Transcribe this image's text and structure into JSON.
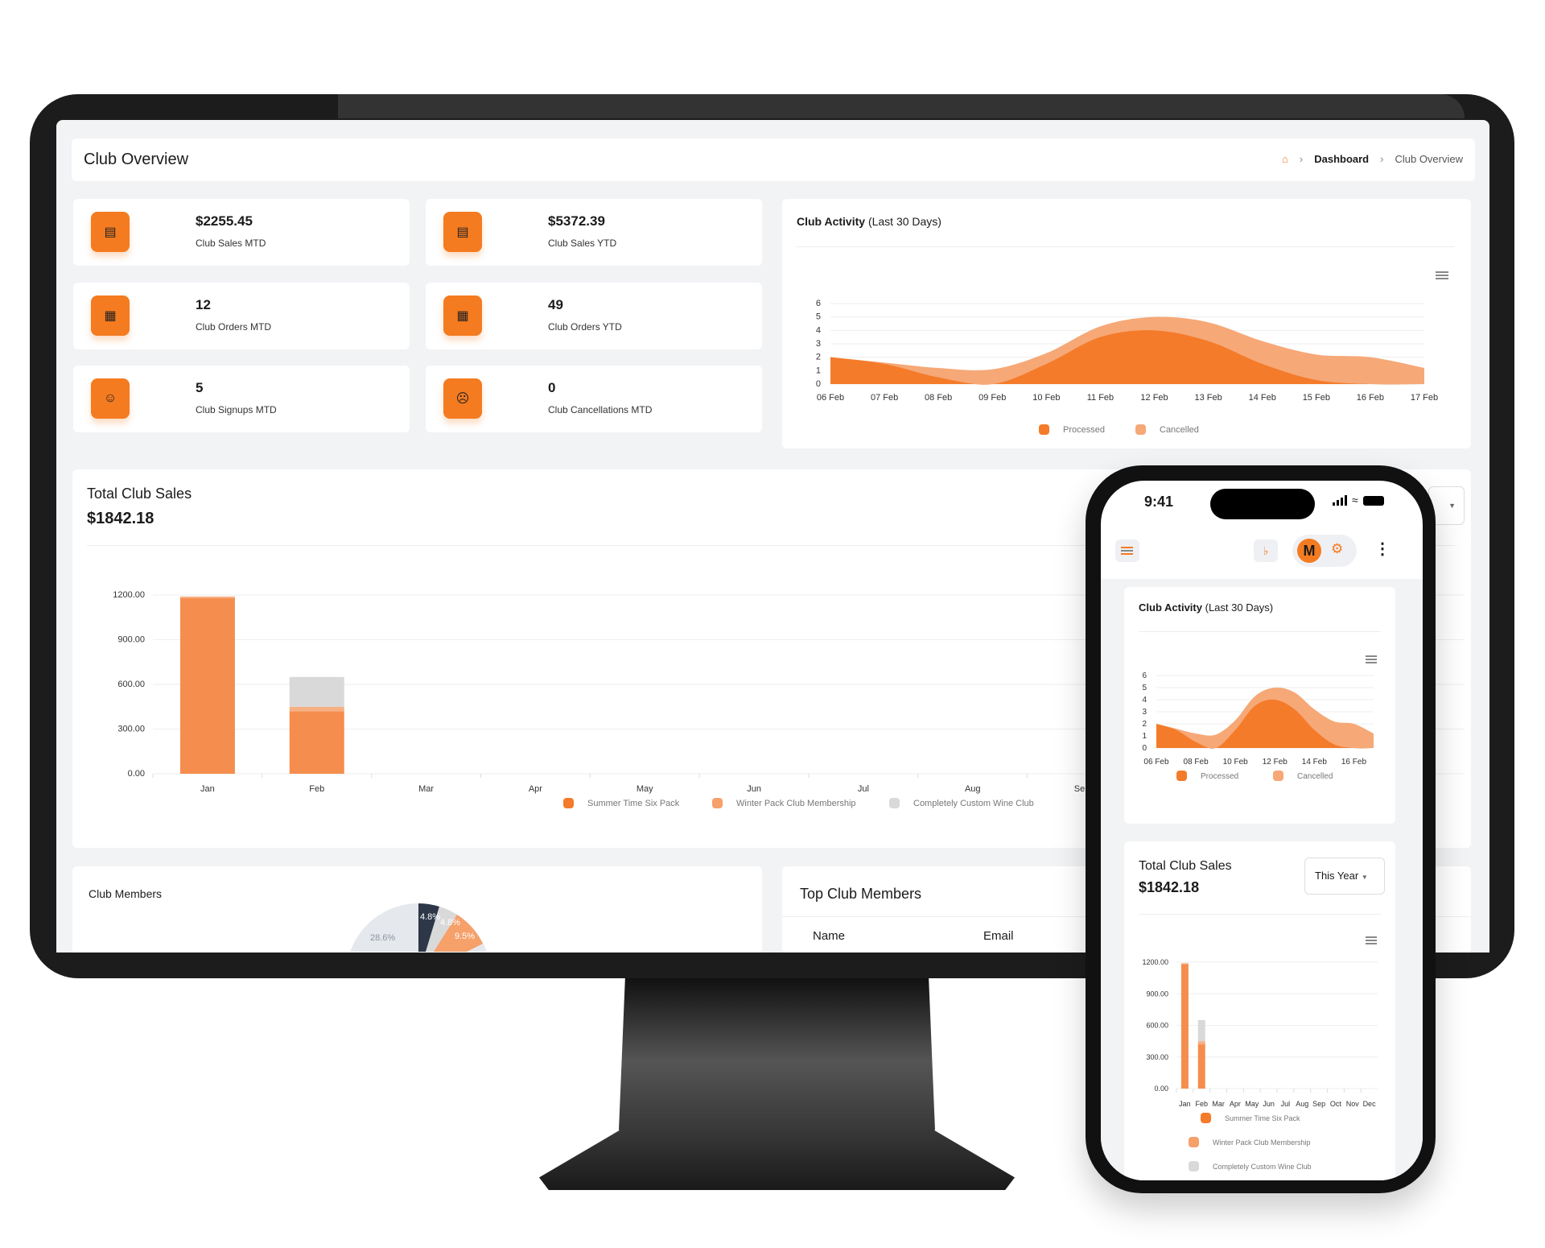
{
  "header": {
    "title": "Club Overview",
    "breadcrumb": [
      "Dashboard",
      "Club Overview"
    ]
  },
  "stats": [
    {
      "value": "$2255.45",
      "label": "Club Sales MTD",
      "icon": "credit-card-icon"
    },
    {
      "value": "$5372.39",
      "label": "Club Sales YTD",
      "icon": "credit-card-icon"
    },
    {
      "value": "12",
      "label": "Club Orders MTD",
      "icon": "document-icon"
    },
    {
      "value": "49",
      "label": "Club Orders YTD",
      "icon": "document-icon"
    },
    {
      "value": "5",
      "label": "Club Signups MTD",
      "icon": "user-icon"
    },
    {
      "value": "0",
      "label": "Club Cancellations MTD",
      "icon": "user-remove-icon"
    }
  ],
  "activity": {
    "title_bold": "Club Activity",
    "title_rest": "(Last 30 Days)"
  },
  "sales": {
    "title": "Total Club Sales",
    "total": "$1842.18",
    "period": "This Year"
  },
  "members": {
    "title": "Club Members",
    "pie_labels": [
      "4.8%",
      "4.8%",
      "9.5%",
      "28.6%"
    ]
  },
  "top_members": {
    "title": "Top Club Members",
    "columns": [
      "Name",
      "Email"
    ]
  },
  "phone": {
    "time": "9:41",
    "avatar": "M"
  },
  "colors": {
    "accent": "#f47b20",
    "processed": "#f47b2a",
    "cancelled": "#f6a877",
    "summer": "#f47b2a",
    "winter": "#f6a06a",
    "custom": "#d9d9d9",
    "dark": "#2d3748"
  },
  "chart_data": [
    {
      "type": "area",
      "stacked": true,
      "x": [
        "06 Feb",
        "07 Feb",
        "08 Feb",
        "09 Feb",
        "10 Feb",
        "11 Feb",
        "12 Feb",
        "13 Feb",
        "14 Feb",
        "15 Feb",
        "16 Feb",
        "17 Feb"
      ],
      "series": [
        {
          "name": "Processed",
          "values": [
            2,
            1.5,
            0.5,
            0,
            1.5,
            3.5,
            4,
            3.2,
            1.5,
            0.3,
            0,
            0
          ]
        },
        {
          "name": "Cancelled",
          "values": [
            0,
            0.1,
            0.7,
            1.1,
            0.8,
            0.8,
            1,
            1.4,
            1.7,
            1.9,
            2,
            1.2
          ]
        }
      ],
      "ylim": [
        0,
        6
      ],
      "yticks": [
        0,
        1,
        2,
        3,
        4,
        5,
        6
      ],
      "grid": true,
      "legend": "bottom"
    },
    {
      "type": "bar",
      "stacked": true,
      "categories": [
        "Jan",
        "Feb",
        "Mar",
        "Apr",
        "May",
        "Jun",
        "Jul",
        "Aug",
        "Sep",
        "Oct",
        "Nov",
        "Dec"
      ],
      "series": [
        {
          "name": "Summer Time Six Pack",
          "values": [
            1180,
            420,
            0,
            0,
            0,
            0,
            0,
            0,
            0,
            0,
            0,
            0
          ]
        },
        {
          "name": "Winter Pack Club Membership",
          "values": [
            10,
            30,
            0,
            0,
            0,
            0,
            0,
            0,
            0,
            0,
            0,
            0
          ]
        },
        {
          "name": "Completely Custom Wine Club",
          "values": [
            0,
            200,
            0,
            0,
            0,
            0,
            0,
            0,
            0,
            0,
            0,
            0
          ]
        }
      ],
      "ylim": [
        0,
        1200
      ],
      "yticks": [
        "0.00",
        "300.00",
        "600.00",
        "900.00",
        "1200.00"
      ],
      "grid": true,
      "legend": "bottom"
    }
  ]
}
